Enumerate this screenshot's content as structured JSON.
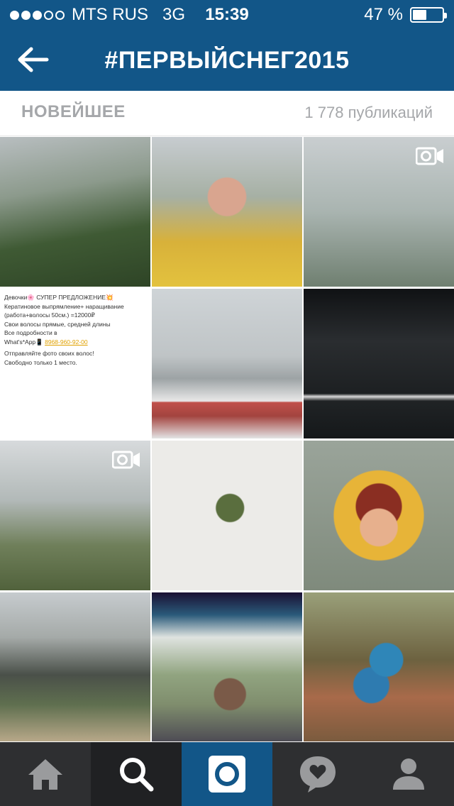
{
  "status_bar": {
    "carrier": "MTS RUS",
    "network": "3G",
    "time": "15:39",
    "battery": "47 %",
    "battery_level": 0.47
  },
  "nav": {
    "title": "#ПЕРВЫЙСНЕГ2015",
    "back_icon": "arrow-left-icon"
  },
  "subheader": {
    "tab_label": "НОВЕЙШЕЕ",
    "count_label": "1 778 публикаций"
  },
  "promo_post": {
    "line1": "Девочки🌸 СУПЕР ПРЕДЛОЖЕНИЕ💥",
    "line2": "Кератиновое выпрямление+ наращивание",
    "line3": "(работа+волосы 50см.) =12000₽",
    "line4": "Свои волосы прямые, средней длины",
    "line5": "Все подробности в",
    "line6_prefix": "What's*App📱",
    "phone": "8968-960-92-00",
    "line7": "Отправляйте фото своих волос!",
    "line8": "Свободно только 1 место."
  },
  "tabbar": {
    "items": [
      "home-icon",
      "search-icon",
      "camera-icon",
      "activity-icon",
      "profile-icon"
    ],
    "active": "search-icon"
  },
  "colors": {
    "header_bg": "#125688",
    "tabbar_bg": "#2e2f31",
    "tabbar_active_bg": "#202123",
    "camera_bg": "#125688",
    "muted_text": "#a5a7aa"
  }
}
